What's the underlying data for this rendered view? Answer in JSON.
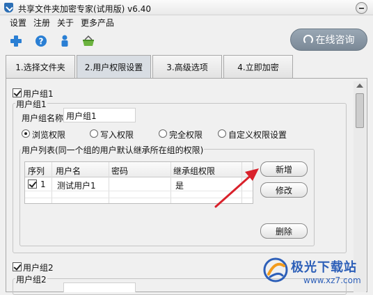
{
  "window": {
    "title": "共享文件夹加密专家(试用版) v6.40"
  },
  "menu": {
    "settings": "设置",
    "register": "注册",
    "about": "关于",
    "more": "更多产品"
  },
  "toolbar": {
    "icons": [
      "add-icon",
      "help-icon",
      "user-icon",
      "basket-icon"
    ]
  },
  "consult_button": {
    "label": "在线咨询"
  },
  "tabs": [
    {
      "label": "1.选择文件夹"
    },
    {
      "label": "2.用户权限设置",
      "active": true
    },
    {
      "label": "3.高级选项"
    },
    {
      "label": "4.立即加密"
    }
  ],
  "group1": {
    "checkbox_label": "用户组1",
    "checked": true,
    "box_title": "用户组1",
    "name_label": "用户组名称",
    "name_value": "用户组1",
    "permissions": [
      {
        "label": "浏览权限",
        "selected": true
      },
      {
        "label": "写入权限",
        "selected": false
      },
      {
        "label": "完全权限",
        "selected": false
      },
      {
        "label": "自定义权限设置",
        "selected": false
      }
    ],
    "user_list_title": "用户列表(同一个组的用户默认继承所在组的权限)",
    "columns": [
      "序列",
      "用户名",
      "密码",
      "继承组权限"
    ],
    "rows": [
      {
        "checked": true,
        "seq": "1",
        "username": "测试用户1",
        "password": "",
        "inherit": "是"
      }
    ],
    "buttons": {
      "add": "新增",
      "edit": "修改",
      "delete": "删除"
    }
  },
  "group2": {
    "checkbox_label": "用户组2",
    "checked": true,
    "box_title": "用户组2"
  },
  "watermark": {
    "name": "极光下载站",
    "url": "www.xz7.com"
  },
  "colors": {
    "annotation_arrow": "#d9212b",
    "consult_bg": "#8896a3",
    "brand_blue": "#2d5fb8"
  }
}
